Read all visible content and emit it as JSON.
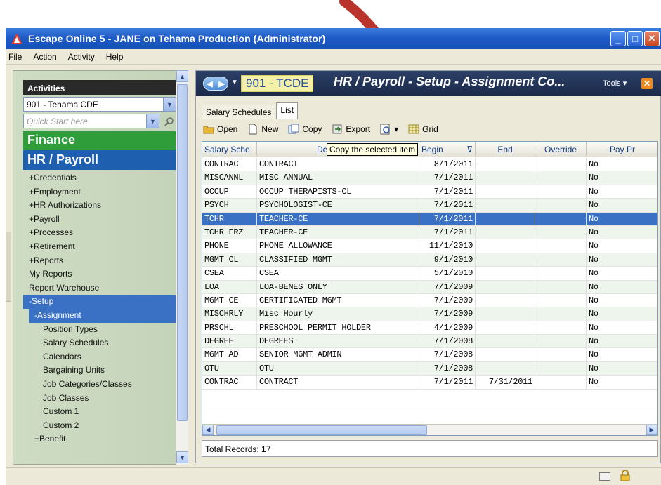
{
  "window": {
    "title": "Escape Online 5 - JANE on Tehama Production (Administrator)"
  },
  "menu": [
    "File",
    "Action",
    "Activity",
    "Help"
  ],
  "left_panel": {
    "header": "Activities",
    "district_select": "901 - Tehama CDE",
    "quick_start_placeholder": "Quick Start here",
    "finance_label": "Finance",
    "hr_label": "HR / Payroll",
    "nav_items": [
      {
        "label": "+Credentials"
      },
      {
        "label": "+Employment"
      },
      {
        "label": "+HR Authorizations"
      },
      {
        "label": "+Payroll"
      },
      {
        "label": "+Processes"
      },
      {
        "label": "+Retirement"
      },
      {
        "label": "+Reports"
      },
      {
        "label": "My Reports"
      },
      {
        "label": "Report Warehouse"
      },
      {
        "label": "-Setup"
      },
      {
        "label": "-Assignment"
      },
      {
        "label": "Position Types"
      },
      {
        "label": "Salary Schedules"
      },
      {
        "label": "Calendars"
      },
      {
        "label": "Bargaining Units"
      },
      {
        "label": "Job Categories/Classes"
      },
      {
        "label": "Job Classes"
      },
      {
        "label": "Custom 1"
      },
      {
        "label": "Custom 2"
      },
      {
        "label": "+Benefit"
      }
    ]
  },
  "right_panel": {
    "district_code": "901 - TCDE",
    "title": "HR / Payroll - Setup - Assignment Co...",
    "tools_label": "Tools",
    "tabs": [
      "Salary Schedules",
      "List"
    ],
    "toolbar": {
      "open": "Open",
      "new": "New",
      "copy": "Copy",
      "export": "Export",
      "grid": "Grid"
    },
    "tooltip": "Copy the selected item",
    "columns": [
      "Salary Sche",
      "Description",
      "Begin",
      "End",
      "Override",
      "Pay Pr"
    ],
    "rows": [
      [
        "CONTRAC",
        "CONTRACT",
        "8/1/2011",
        "",
        "",
        "No"
      ],
      [
        "MISCANNL",
        "MISC ANNUAL",
        "7/1/2011",
        "",
        "",
        "No"
      ],
      [
        "OCCUP",
        "OCCUP THERAPISTS-CL",
        "7/1/2011",
        "",
        "",
        "No"
      ],
      [
        "PSYCH",
        "PSYCHOLOGIST-CE",
        "7/1/2011",
        "",
        "",
        "No"
      ],
      [
        "TCHR",
        "TEACHER-CE",
        "7/1/2011",
        "",
        "",
        "No"
      ],
      [
        "TCHR FRZ",
        "TEACHER-CE",
        "7/1/2011",
        "",
        "",
        "No"
      ],
      [
        "PHONE",
        "PHONE ALLOWANCE",
        "11/1/2010",
        "",
        "",
        "No"
      ],
      [
        "MGMT CL",
        "CLASSIFIED MGMT",
        "9/1/2010",
        "",
        "",
        "No"
      ],
      [
        "CSEA",
        "CSEA",
        "5/1/2010",
        "",
        "",
        "No"
      ],
      [
        "LOA",
        "LOA-BENES ONLY",
        "7/1/2009",
        "",
        "",
        "No"
      ],
      [
        "MGMT CE",
        "CERTIFICATED MGMT",
        "7/1/2009",
        "",
        "",
        "No"
      ],
      [
        "MISCHRLY",
        "Misc Hourly",
        "7/1/2009",
        "",
        "",
        "No"
      ],
      [
        "PRSCHL",
        "PRESCHOOL PERMIT HOLDER",
        "4/1/2009",
        "",
        "",
        "No"
      ],
      [
        "DEGREE",
        "DEGREES",
        "7/1/2008",
        "",
        "",
        "No"
      ],
      [
        "MGMT AD",
        "SENIOR MGMT ADMIN",
        "7/1/2008",
        "",
        "",
        "No"
      ],
      [
        "OTU",
        "OTU",
        "7/1/2008",
        "",
        "",
        "No"
      ],
      [
        "CONTRAC",
        "CONTRACT",
        "7/1/2011",
        "7/31/2011",
        "",
        "No"
      ]
    ],
    "selected_row_index": 4,
    "total_records": "Total Records: 17"
  },
  "colors": {
    "title_bar": "#1f5cc8",
    "finance": "#2f9e3a",
    "hr_payroll": "#1f5fb0",
    "selection": "#3b71c4",
    "annotation_arrow": "#b8342c"
  }
}
